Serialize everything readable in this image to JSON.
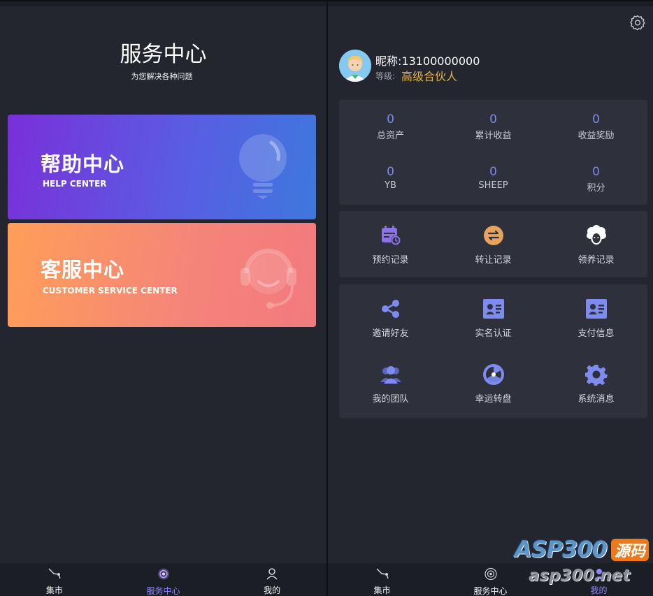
{
  "left": {
    "title": "服务中心",
    "subtitle": "为您解决各种问题",
    "help_card": {
      "title": "帮助中心",
      "subtitle": "HELP CENTER",
      "icon": "lightbulb-icon"
    },
    "cs_card": {
      "title": "客服中心",
      "subtitle": "CUSTOMER SERVICE CENTER",
      "icon": "headset-agent-icon"
    },
    "tabs": [
      {
        "label": "集市",
        "icon": "market-icon",
        "active": false
      },
      {
        "label": "服务中心",
        "icon": "service-icon",
        "active": true
      },
      {
        "label": "我的",
        "icon": "user-icon",
        "active": false
      }
    ]
  },
  "right": {
    "profile": {
      "nickname": "昵称:13100000000",
      "level_label": "等级:",
      "level_value": "高级合伙人"
    },
    "stats": [
      {
        "value": "0",
        "label": "总资产"
      },
      {
        "value": "0",
        "label": "累计收益"
      },
      {
        "value": "0",
        "label": "收益奖励"
      },
      {
        "value": "0",
        "label": "YB"
      },
      {
        "value": "0",
        "label": "SHEEP"
      },
      {
        "value": "0",
        "label": "积分"
      }
    ],
    "records": [
      {
        "label": "预约记录",
        "icon": "calendar-clock-icon"
      },
      {
        "label": "转让记录",
        "icon": "transfer-icon"
      },
      {
        "label": "领养记录",
        "icon": "sheep-icon"
      }
    ],
    "tools": [
      {
        "label": "邀请好友",
        "icon": "share-icon"
      },
      {
        "label": "实名认证",
        "icon": "id-card-icon"
      },
      {
        "label": "支付信息",
        "icon": "id-card-icon"
      },
      {
        "label": "我的团队",
        "icon": "team-icon"
      },
      {
        "label": "幸运转盘",
        "icon": "wheel-icon"
      },
      {
        "label": "系统消息",
        "icon": "gear-icon"
      }
    ],
    "tabs": [
      {
        "label": "集市",
        "icon": "market-icon",
        "active": false
      },
      {
        "label": "服务中心",
        "icon": "service-icon",
        "active": false
      },
      {
        "label": "我的",
        "icon": "user-icon",
        "active": true
      }
    ]
  },
  "watermark": {
    "brand": "ASP300",
    "badge": "源码",
    "url": "asp300.net"
  },
  "colors": {
    "accent": "#7e8bef",
    "gold": "#e8b23e",
    "active_tab": "#8f87ff",
    "panel_bg": "#23262f",
    "box_bg": "#2e313c"
  }
}
